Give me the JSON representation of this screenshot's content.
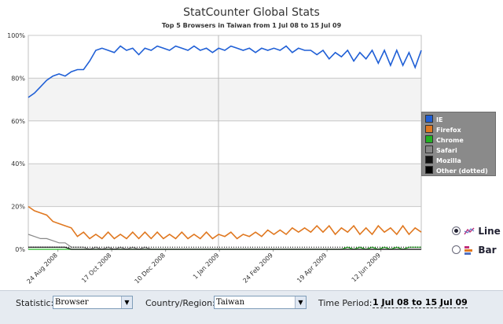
{
  "header": {
    "title": "StatCounter Global Stats",
    "subtitle": "Top 5 Browsers in Taiwan from 1 Jul 08 to 15 Jul 09"
  },
  "chart_data": {
    "type": "line",
    "title": "StatCounter Global Stats",
    "subtitle": "Top 5 Browsers in Taiwan from 1 Jul 08 to 15 Jul 09",
    "xlabel": "",
    "ylabel": "",
    "ylim": [
      0,
      100
    ],
    "y_ticks": [
      "0%",
      "20%",
      "40%",
      "60%",
      "80%",
      "100%"
    ],
    "x_tick_labels": [
      "24 Aug 2008",
      "17 Oct 2008",
      "10 Dec 2008",
      "1 Jan 2009",
      "24 Feb 2009",
      "19 Apr 2009",
      "12 Jun 2009"
    ],
    "grid": true,
    "legend_position": "right",
    "series": [
      {
        "name": "IE",
        "color": "#1f5fd6",
        "values": [
          71,
          73,
          76,
          79,
          81,
          82,
          81,
          83,
          84,
          84,
          88,
          93,
          94,
          93,
          92,
          95,
          93,
          94,
          91,
          94,
          93,
          95,
          94,
          93,
          95,
          94,
          93,
          95,
          93,
          94,
          92,
          94,
          93,
          95,
          94,
          93,
          94,
          92,
          94,
          93,
          94,
          93,
          95,
          92,
          94,
          93,
          93,
          91,
          93,
          89,
          92,
          90,
          93,
          88,
          92,
          89,
          93,
          87,
          93,
          86,
          93,
          86,
          92,
          85,
          93
        ]
      },
      {
        "name": "Firefox",
        "color": "#e07820",
        "values": [
          20,
          18,
          17,
          16,
          13,
          12,
          11,
          10,
          6,
          8,
          5,
          7,
          5,
          8,
          5,
          7,
          5,
          8,
          5,
          8,
          5,
          8,
          5,
          7,
          5,
          8,
          5,
          7,
          5,
          8,
          5,
          7,
          6,
          8,
          5,
          7,
          6,
          8,
          6,
          9,
          7,
          9,
          7,
          10,
          8,
          10,
          8,
          11,
          8,
          11,
          7,
          10,
          8,
          11,
          7,
          10,
          7,
          11,
          8,
          10,
          7,
          11,
          7,
          10,
          8
        ]
      },
      {
        "name": "Chrome",
        "color": "#22b222",
        "values": [
          0,
          0,
          0,
          0,
          0,
          0,
          0,
          0,
          0,
          0,
          0,
          0,
          0,
          0,
          0,
          0,
          0,
          0,
          0,
          0,
          0,
          0,
          0,
          0,
          0,
          0,
          0,
          0,
          0,
          0,
          0,
          0,
          0,
          0,
          0,
          0,
          0,
          0,
          0,
          0,
          0,
          0,
          0,
          0,
          0,
          0,
          0,
          0,
          0,
          0,
          0,
          0,
          1,
          0,
          1,
          0,
          1,
          0,
          1,
          0,
          1,
          0,
          1,
          1,
          1
        ]
      },
      {
        "name": "Safari",
        "color": "#888888",
        "values": [
          7,
          6,
          5,
          5,
          4,
          3,
          3,
          1,
          1,
          1,
          0,
          1,
          0,
          1,
          0,
          1,
          0,
          1,
          0,
          1,
          0,
          0,
          0,
          0,
          0,
          0,
          0,
          0,
          0,
          0,
          0,
          0,
          0,
          0,
          0,
          0,
          0,
          0,
          0,
          0,
          0,
          0,
          0,
          0,
          0,
          0,
          0,
          0,
          0,
          0,
          0,
          0,
          0,
          0,
          0,
          0,
          0,
          0,
          0,
          0,
          0,
          0,
          0,
          0,
          0
        ]
      },
      {
        "name": "Mozilla",
        "color": "#111111",
        "values": [
          1,
          1,
          1,
          1,
          1,
          1,
          1,
          0,
          0,
          0,
          0,
          0,
          0,
          0,
          0,
          0,
          0,
          0,
          0,
          0,
          0,
          0,
          0,
          0,
          0,
          0,
          0,
          0,
          0,
          0,
          0,
          0,
          0,
          0,
          0,
          0,
          0,
          0,
          0,
          0,
          0,
          0,
          0,
          0,
          0,
          0,
          0,
          0,
          0,
          0,
          0,
          0,
          0,
          0,
          0,
          0,
          0,
          0,
          0,
          0,
          0,
          0,
          0,
          0,
          0
        ]
      },
      {
        "name": "Other (dotted)",
        "color": "#000000",
        "dotted": true,
        "values": [
          1,
          1,
          1,
          1,
          1,
          1,
          1,
          1,
          1,
          1,
          1,
          1,
          1,
          1,
          1,
          1,
          1,
          1,
          1,
          1,
          1,
          1,
          1,
          1,
          1,
          1,
          1,
          1,
          1,
          1,
          1,
          1,
          1,
          1,
          1,
          1,
          1,
          1,
          1,
          1,
          1,
          1,
          1,
          1,
          1,
          1,
          1,
          1,
          1,
          1,
          1,
          1,
          1,
          1,
          1,
          1,
          1,
          1,
          1,
          1,
          1,
          1,
          1,
          1,
          1
        ]
      }
    ]
  },
  "legend": {
    "items": [
      {
        "label": "IE",
        "color": "#1f5fd6"
      },
      {
        "label": "Firefox",
        "color": "#e07820"
      },
      {
        "label": "Chrome",
        "color": "#22b222"
      },
      {
        "label": "Safari",
        "color": "#888888"
      },
      {
        "label": "Mozilla",
        "color": "#111111"
      },
      {
        "label": "Other (dotted)",
        "color": "#000000"
      }
    ]
  },
  "view_options": {
    "line_label": "Line",
    "bar_label": "Bar",
    "selected": "Line"
  },
  "controls": {
    "statistic_label": "Statistic:",
    "statistic_value": "Browser",
    "country_label": "Country/Region:",
    "country_value": "Taiwan",
    "period_label": "Time Period:",
    "period_value": "1 Jul 08 to 15 Jul 09"
  }
}
